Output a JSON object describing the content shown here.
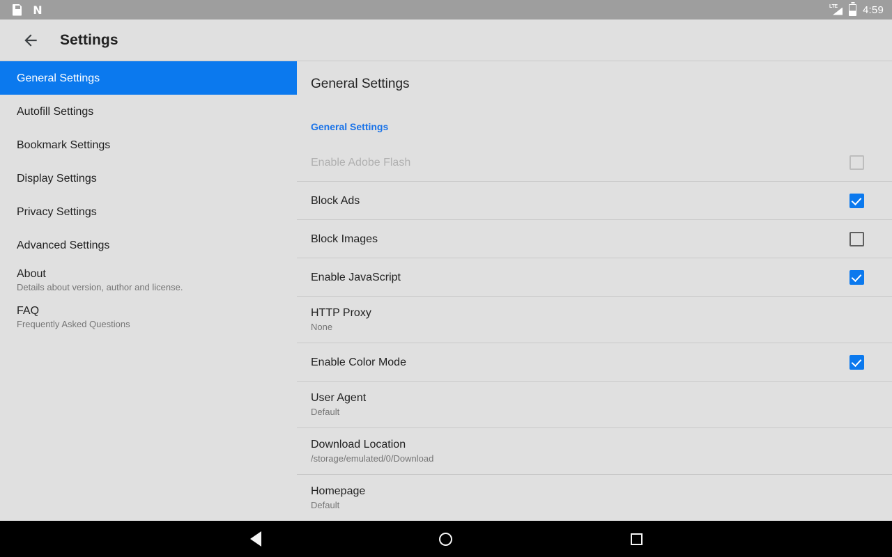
{
  "statusbar": {
    "left_icons": [
      "sd-card-icon",
      "nova-launcher-icon"
    ],
    "network_label": "LTE",
    "right_icons": [
      "lte-signal-icon",
      "battery-icon"
    ],
    "time": "4:59"
  },
  "appbar": {
    "back_icon": "back-arrow-icon",
    "title": "Settings"
  },
  "sidebar": {
    "items": [
      {
        "label": "General Settings",
        "sub": "",
        "selected": true
      },
      {
        "label": "Autofill Settings",
        "sub": "",
        "selected": false
      },
      {
        "label": "Bookmark Settings",
        "sub": "",
        "selected": false
      },
      {
        "label": "Display Settings",
        "sub": "",
        "selected": false
      },
      {
        "label": "Privacy Settings",
        "sub": "",
        "selected": false
      },
      {
        "label": "Advanced Settings",
        "sub": "",
        "selected": false
      },
      {
        "label": "About",
        "sub": "Details about version, author and license.",
        "selected": false
      },
      {
        "label": "FAQ",
        "sub": "Frequently Asked Questions",
        "selected": false
      }
    ]
  },
  "panel": {
    "title": "General Settings",
    "section_header": "General Settings",
    "rows": [
      {
        "title": "Enable Adobe Flash",
        "sub": "",
        "control": "checkbox",
        "state": "disabled"
      },
      {
        "title": "Block Ads",
        "sub": "",
        "control": "checkbox",
        "state": "checked"
      },
      {
        "title": "Block Images",
        "sub": "",
        "control": "checkbox",
        "state": "unchecked"
      },
      {
        "title": "Enable JavaScript",
        "sub": "",
        "control": "checkbox",
        "state": "checked"
      },
      {
        "title": "HTTP Proxy",
        "sub": "None",
        "control": "none",
        "state": ""
      },
      {
        "title": "Enable Color Mode",
        "sub": "",
        "control": "checkbox",
        "state": "checked"
      },
      {
        "title": "User Agent",
        "sub": "Default",
        "control": "none",
        "state": ""
      },
      {
        "title": "Download Location",
        "sub": "/storage/emulated/0/Download",
        "control": "none",
        "state": ""
      },
      {
        "title": "Homepage",
        "sub": "Default",
        "control": "none",
        "state": ""
      }
    ]
  },
  "navbar": {
    "buttons": [
      "back-nav-button",
      "home-nav-button",
      "recents-nav-button"
    ]
  },
  "colors": {
    "accent": "#0b79ee",
    "section_header": "#1a73e8",
    "background": "#e0e0e0",
    "statusbar": "#9e9e9e",
    "navbar": "#000000"
  }
}
